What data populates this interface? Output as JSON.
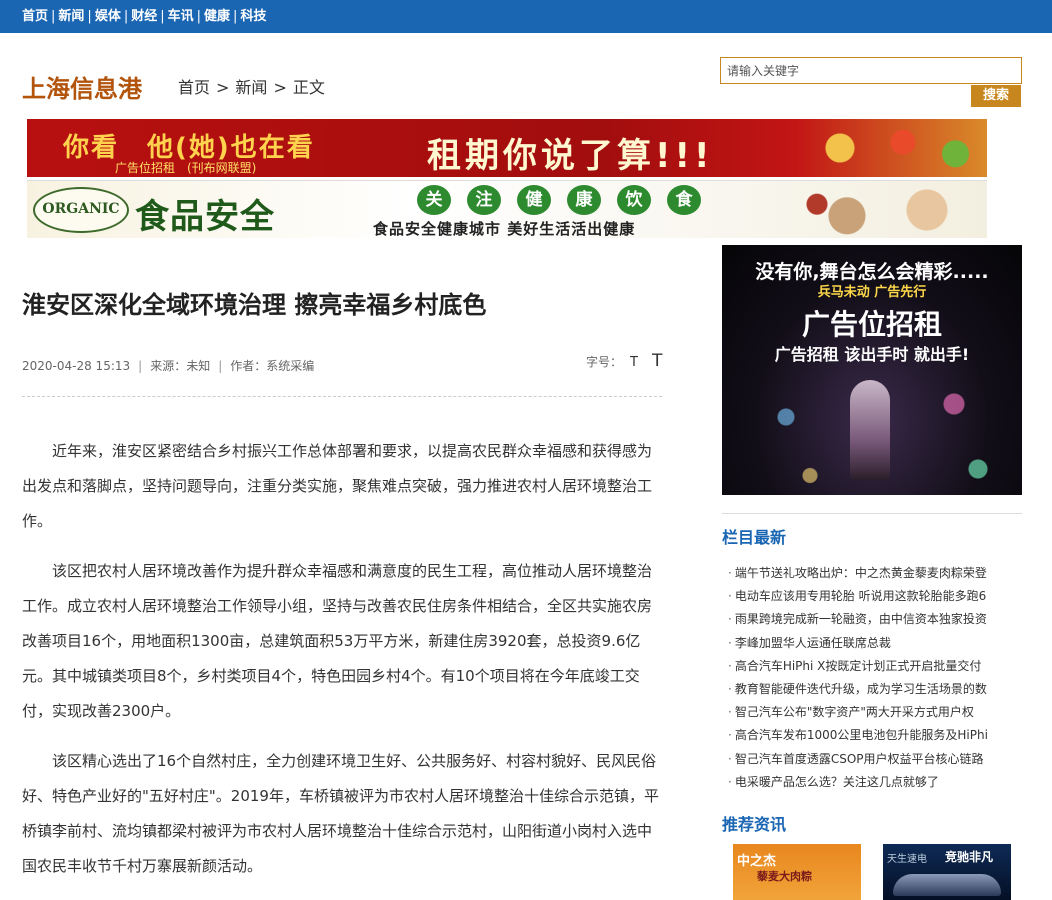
{
  "topnav": [
    "首页",
    "新闻",
    "娱体",
    "财经",
    "车讯",
    "健康",
    "科技"
  ],
  "topnav_sep": "|",
  "site": {
    "logo": "上海信息港"
  },
  "breadcrumb": {
    "home": "首页",
    "news": "新闻",
    "current": "正文",
    "sep": ">"
  },
  "search": {
    "placeholder": "请输入关键字",
    "button": "搜索"
  },
  "banner1": {
    "headline": "你看　他(她)也在看",
    "sub": "广告位招租　(刊布网联盟)",
    "slogan": "租期你说了算!!!"
  },
  "banner2": {
    "organic": "ORGANIC",
    "safety": "食品安全",
    "chars": [
      "关",
      "注",
      "健",
      "康",
      "饮",
      "食"
    ],
    "slogan": "食品安全健康城市 美好生活活出健康"
  },
  "article": {
    "title": "淮安区深化全域环境治理 擦亮幸福乡村底色",
    "date": "2020-04-28 15:13",
    "source": "来源：未知",
    "author": "作者：系统采编",
    "fontsize_label": "字号：",
    "fontsize_small": "T",
    "fontsize_large": "T",
    "paragraphs": [
      "近年来，淮安区紧密结合乡村振兴工作总体部署和要求，以提高农民群众幸福感和获得感为出发点和落脚点，坚持问题导向，注重分类实施，聚焦难点突破，强力推进农村人居环境整治工作。",
      "该区把农村人居环境改善作为提升群众幸福感和满意度的民生工程，高位推动人居环境整治工作。成立农村人居环境整治工作领导小组，坚持与改善农民住房条件相结合，全区共实施农房改善项目16个，用地面积1300亩，总建筑面积53万平方米，新建住房3920套，总投资9.6亿元。其中城镇类项目8个，乡村类项目4个，特色田园乡村4个。有10个项目将在今年底竣工交付，实现改善2300户。",
      "该区精心选出了16个自然村庄，全力创建环境卫生好、公共服务好、村容村貌好、民风民俗好、特色产业好的\"五好村庄\"。2019年，车桥镇被评为市农村人居环境整治十佳综合示范镇，平桥镇李前村、流均镇都梁村被评为市农村人居环境整治十佳综合示范村，山阳街道小岗村入选中国农民丰收节千村万寨展新颜活动。"
    ]
  },
  "side_ad": {
    "line1": "没有你,舞台怎么会精彩.....",
    "line2": "兵马未动 广告先行",
    "line3": "广告位招租",
    "line4": "广告招租 该出手时 就出手!"
  },
  "latest": {
    "heading": "栏目最新",
    "items": [
      "端午节送礼攻略出炉：中之杰黄金藜麦肉粽荣登",
      "电动车应该用专用轮胎 听说用这款轮胎能多跑6",
      "雨果跨境完成新一轮融资，由中信资本独家投资",
      "李峰加盟华人运通任联席总裁",
      "高合汽车HiPhi X按既定计划正式开启批量交付",
      "教育智能硬件迭代升级，成为学习生活场景的数",
      "智己汽车公布\"数字资产\"两大开采方式用户权",
      "高合汽车发布1000公里电池包升能服务及HiPhi",
      "智己汽车首度透露CSOP用户权益平台核心链路",
      "电采暖产品怎么选？关注这几点就够了"
    ]
  },
  "recommend": {
    "heading": "推荐资讯",
    "thumb1_logo": "中之杰",
    "thumb1_sub": "藜麦大肉粽",
    "thumb2_small": "天生速电",
    "thumb2_big": "竞驰非凡"
  }
}
